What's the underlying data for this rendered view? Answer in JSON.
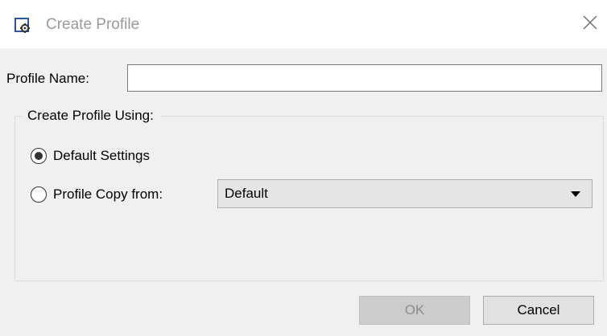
{
  "window": {
    "title": "Create Profile",
    "icon": "profile-settings-icon",
    "close_icon": "close-icon"
  },
  "form": {
    "profile_name_label": "Profile Name:",
    "profile_name_value": "",
    "group_label": "Create Profile Using:",
    "options": [
      {
        "label": "Default Settings",
        "selected": true
      },
      {
        "label": "Profile Copy from:",
        "selected": false
      }
    ],
    "copy_from_value": "Default"
  },
  "buttons": {
    "ok_label": "OK",
    "ok_enabled": false,
    "cancel_label": "Cancel"
  }
}
